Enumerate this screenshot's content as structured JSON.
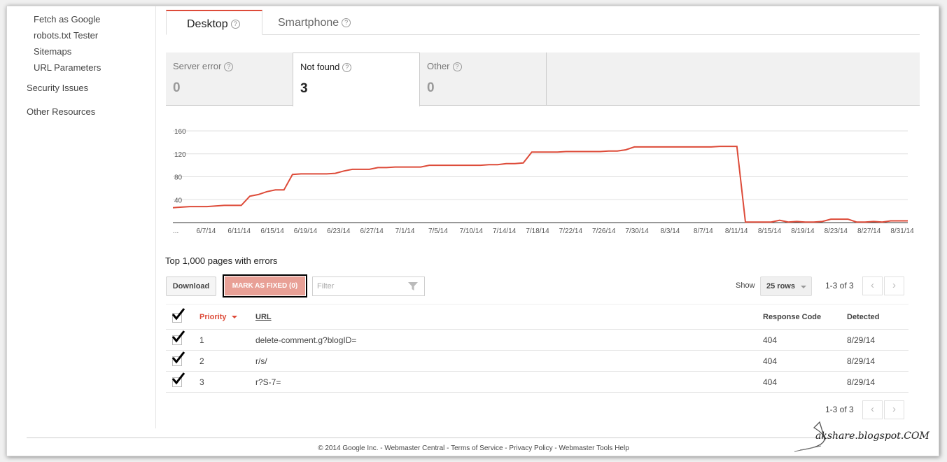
{
  "sidebar": {
    "items": [
      {
        "label": "Fetch as Google"
      },
      {
        "label": "robots.txt Tester"
      },
      {
        "label": "Sitemaps"
      },
      {
        "label": "URL Parameters"
      },
      {
        "label": "Security Issues"
      },
      {
        "label": "Other Resources"
      }
    ]
  },
  "tabs": [
    {
      "label": "Desktop",
      "active": true
    },
    {
      "label": "Smartphone",
      "active": false
    }
  ],
  "help_glyph": "?",
  "cards": [
    {
      "label": "Server error",
      "count": "0"
    },
    {
      "label": "Not found",
      "count": "3",
      "active": true
    },
    {
      "label": "Other",
      "count": "0"
    }
  ],
  "chart_data": {
    "type": "line",
    "title": "",
    "ylim": [
      0,
      160
    ],
    "yticks": [
      "160",
      "120",
      "80",
      "40"
    ],
    "xticks": [
      "...",
      "6/7/14",
      "6/11/14",
      "6/15/14",
      "6/19/14",
      "6/23/14",
      "6/27/14",
      "7/1/14",
      "7/5/14",
      "7/10/14",
      "7/14/14",
      "7/18/14",
      "7/22/14",
      "7/26/14",
      "7/30/14",
      "8/3/14",
      "8/7/14",
      "8/11/14",
      "8/15/14",
      "8/19/14",
      "8/23/14",
      "8/27/14",
      "8/31/14"
    ],
    "series": [
      {
        "color": "#dd4b39",
        "values": [
          26,
          27,
          28,
          28,
          28,
          29,
          30,
          30,
          30,
          46,
          49,
          54,
          57,
          57,
          84,
          85,
          85,
          85,
          85,
          86,
          90,
          93,
          93,
          93,
          96,
          96,
          97,
          97,
          97,
          97,
          100,
          100,
          100,
          100,
          100,
          100,
          100,
          101,
          101,
          103,
          103,
          104,
          123,
          123,
          123,
          123,
          124,
          124,
          124,
          124,
          124,
          125,
          125,
          127,
          132,
          132,
          132,
          132,
          132,
          132,
          132,
          132,
          132,
          132,
          133,
          133,
          133,
          1,
          1,
          1,
          1,
          4,
          1,
          2,
          1,
          1,
          2,
          6,
          6,
          6,
          1,
          1,
          2,
          1,
          3,
          3,
          3
        ]
      }
    ]
  },
  "table_section": {
    "title": "Top 1,000 pages with errors",
    "download_label": "Download",
    "mark_fixed_label": "MARK AS FIXED (0)",
    "filter_placeholder": "Filter",
    "show_label": "Show",
    "rows_select": "25 rows",
    "pager_text": "1-3 of 3",
    "prev_glyph": "‹",
    "next_glyph": "›",
    "headers": {
      "priority": "Priority",
      "url": "URL",
      "response_code": "Response Code",
      "detected": "Detected"
    },
    "rows": [
      {
        "priority": "1",
        "url": "delete-comment.g?blogID=",
        "response_code": "404",
        "detected": "8/29/14"
      },
      {
        "priority": "2",
        "url": "r/s/",
        "response_code": "404",
        "detected": "8/29/14"
      },
      {
        "priority": "3",
        "url": "r?S-7=",
        "response_code": "404",
        "detected": "8/29/14"
      }
    ]
  },
  "footer": {
    "text": "© 2014 Google Inc. - Webmaster Central - Terms of Service - Privacy Policy - Webmaster Tools Help"
  },
  "watermark": {
    "text": "akshare.blogspot.COM"
  },
  "colors": {
    "accent": "#dd4b39",
    "mark_button": "#e8a096"
  }
}
